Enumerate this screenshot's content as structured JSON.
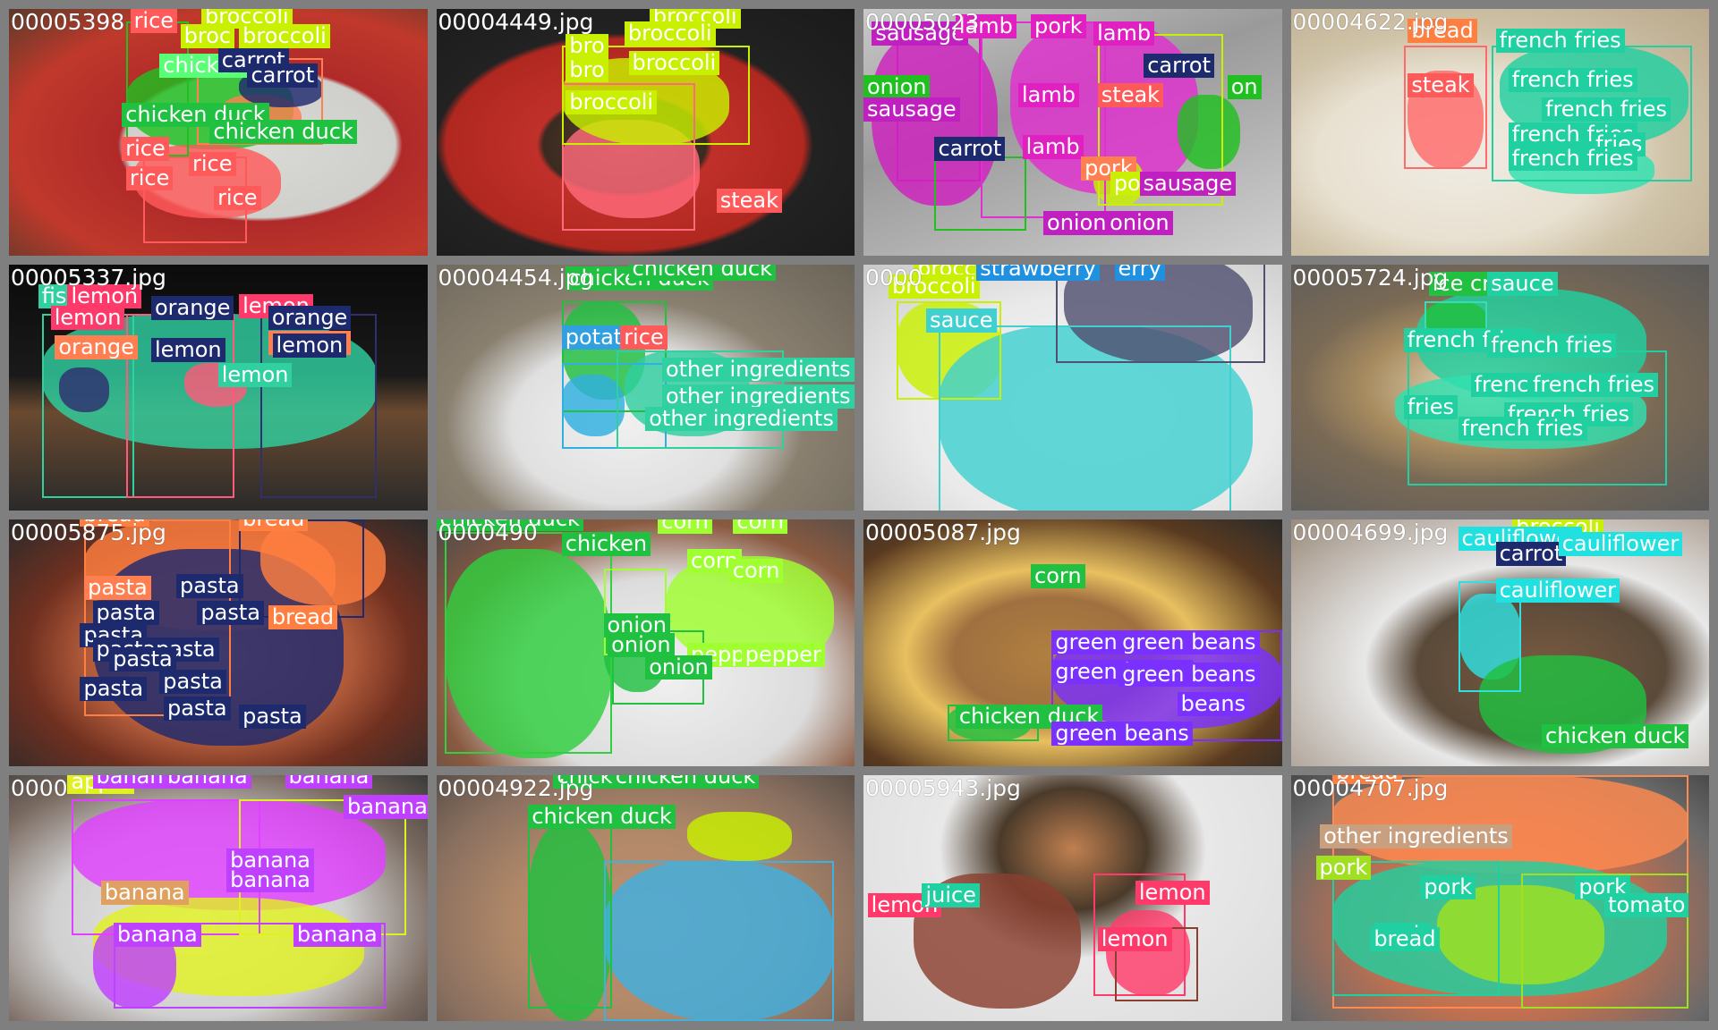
{
  "tiles": [
    {
      "filename": "00005398",
      "bg": "radial-gradient(ellipse at 60% 55%, #d9d9d6 0%, #cfcfcb 38%, #b02a2a 40%, #c0392b 70%, #5a3a2a 100%)",
      "blobs": [
        {
          "color": "#20c020"
        },
        {
          "color": "#ff5a5a"
        },
        {
          "color": "#ff7f50"
        },
        {
          "color": "#1e2a6e"
        }
      ],
      "labels": [
        {
          "text": "rice",
          "color": "#ff5a5a"
        },
        {
          "text": "broccoli",
          "color": "#c8f000"
        },
        {
          "text": "broc",
          "color": "#c8f000"
        },
        {
          "text": "broccoli",
          "color": "#c8f000"
        },
        {
          "text": "chicken",
          "color": "#5aff78"
        },
        {
          "text": "carrot",
          "color": "#1e2a6e"
        },
        {
          "text": "carrot",
          "color": "#1e2a6e"
        },
        {
          "text": "chicken duck",
          "color": "#20c040"
        },
        {
          "text": "chicken duck",
          "color": "#20c040"
        },
        {
          "text": "rice",
          "color": "#ff5a5a"
        },
        {
          "text": "rice",
          "color": "#ff5a5a"
        },
        {
          "text": "rice",
          "color": "#ff5a5a"
        },
        {
          "text": "rice",
          "color": "#ff5a5a"
        }
      ]
    },
    {
      "filename": "00004449.jpg",
      "bg": "radial-gradient(ellipse at 45% 55%, #5a4030 0%, #3a2a20 25%, #c0302a 27%, #b02820 55%, #222 58%, #1a1a1a 100%)",
      "blobs": [
        {
          "color": "#ff6a7a"
        },
        {
          "color": "#c8f000"
        }
      ],
      "labels": [
        {
          "text": "broccoli",
          "color": "#c8f000"
        },
        {
          "text": "bro",
          "color": "#c8f000"
        },
        {
          "text": "broccoli",
          "color": "#c8f000"
        },
        {
          "text": "bro",
          "color": "#c8f000"
        },
        {
          "text": "broccoli",
          "color": "#c8f000"
        },
        {
          "text": "broccoli",
          "color": "#c8f000"
        },
        {
          "text": "steak",
          "color": "#ff5a5a"
        }
      ]
    },
    {
      "filename": "00005023",
      "bg": "linear-gradient(160deg, #c9c9c9 0%, #9a9a9a 40%, #d0d0d0 100%)",
      "blobs": [
        {
          "color": "#d020c0"
        },
        {
          "color": "#e030d0"
        },
        {
          "color": "#20c020"
        },
        {
          "color": "#c8f000"
        }
      ],
      "labels": [
        {
          "text": "sausage",
          "color": "#c020c0"
        },
        {
          "text": "lamb",
          "color": "#e020c0"
        },
        {
          "text": "pork",
          "color": "#e020c0"
        },
        {
          "text": "lamb",
          "color": "#e020c0"
        },
        {
          "text": "onion",
          "color": "#20c020"
        },
        {
          "text": "carrot",
          "color": "#1e2a6e"
        },
        {
          "text": "on",
          "color": "#20c020"
        },
        {
          "text": "sausage",
          "color": "#c020c0"
        },
        {
          "text": "lamb",
          "color": "#e020c0"
        },
        {
          "text": "steak",
          "color": "#ff5a5a"
        },
        {
          "text": "carrot",
          "color": "#1e2a6e"
        },
        {
          "text": "lamb",
          "color": "#e020c0"
        },
        {
          "text": "pork",
          "color": "#ff7f50"
        },
        {
          "text": "pork",
          "color": "#c8f000"
        },
        {
          "text": "sausage",
          "color": "#c020c0"
        },
        {
          "text": "onion",
          "color": "#c020c0"
        },
        {
          "text": "onion",
          "color": "#c020c0"
        }
      ]
    },
    {
      "filename": "00004622.jpg",
      "bg": "radial-gradient(ellipse at 40% 60%, #f0ece4 0%, #e8e0d0 40%, #cfc3a8 60%, #b9a88c 100%)",
      "blobs": [
        {
          "color": "#ff6a6a"
        },
        {
          "color": "#20d0a0"
        },
        {
          "color": "#30e0b0"
        }
      ],
      "labels": [
        {
          "text": "bread",
          "color": "#ff7f40"
        },
        {
          "text": "french fries",
          "color": "#20d0a0"
        },
        {
          "text": "steak",
          "color": "#ff5a5a"
        },
        {
          "text": "french fries",
          "color": "#20d0a0"
        },
        {
          "text": "french fries",
          "color": "#20d0a0"
        },
        {
          "text": "french fries",
          "color": "#20d0a0"
        },
        {
          "text": "fries",
          "color": "#20d0a0"
        },
        {
          "text": "french fries",
          "color": "#20d0a0"
        }
      ]
    },
    {
      "filename": "00005337.jpg",
      "bg": "linear-gradient(180deg, #0b0b0b 0%, #1a1a1a 45%, #6a4a30 60%, #2a2a2a 100%)",
      "blobs": [
        {
          "color": "#30d0a0"
        },
        {
          "color": "#ff5a7a"
        },
        {
          "color": "#303070"
        }
      ],
      "labels": [
        {
          "text": "fish",
          "color": "#30d0a0"
        },
        {
          "text": "lemon",
          "color": "#ff3a6a"
        },
        {
          "text": "lemon",
          "color": "#ff3a6a"
        },
        {
          "text": "orange",
          "color": "#1e2a6e"
        },
        {
          "text": "lemon",
          "color": "#ff3a6a"
        },
        {
          "text": "orange",
          "color": "#ff7f50"
        },
        {
          "text": "lemon",
          "color": "#1e2a6e"
        },
        {
          "text": "orange",
          "color": "#1e2a6e"
        },
        {
          "text": "orange",
          "color": "#ff7f50"
        },
        {
          "text": "lemon",
          "color": "#30d0a0"
        },
        {
          "text": "lemon",
          "color": "#1e2a6e"
        }
      ]
    },
    {
      "filename": "00004454.jpg",
      "bg": "radial-gradient(ellipse at 45% 65%, #f0f0f0 0%, #e0e0e0 35%, #8a8070 55%, #6a6458 100%)",
      "blobs": [
        {
          "color": "#20c040"
        },
        {
          "color": "#30b0e0"
        },
        {
          "color": "#30d0a0"
        }
      ],
      "labels": [
        {
          "text": "chicken duck",
          "color": "#20c040"
        },
        {
          "text": "chicken duck",
          "color": "#20c040"
        },
        {
          "text": "potato",
          "color": "#30a0e0"
        },
        {
          "text": "rice",
          "color": "#ff5a5a"
        },
        {
          "text": "other ingredients",
          "color": "#30d0a0"
        },
        {
          "text": "other ingredients",
          "color": "#30d0a0"
        },
        {
          "text": "other ingredients",
          "color": "#30d0a0"
        }
      ]
    },
    {
      "filename": "0000",
      "bg": "radial-gradient(ellipse at 55% 60%, #f4f4f4 0%, #eaeaea 55%, #c9c9c9 100%)",
      "blobs": [
        {
          "color": "#c8f000"
        },
        {
          "color": "#40d0d0"
        },
        {
          "color": "#505070"
        }
      ],
      "labels": [
        {
          "text": "broccoli",
          "color": "#c8f000"
        },
        {
          "text": "broccoli",
          "color": "#c8f000"
        },
        {
          "text": "strawberry",
          "color": "#2090e0"
        },
        {
          "text": "erry",
          "color": "#2090e0"
        },
        {
          "text": "sauce",
          "color": "#40d0d0"
        }
      ]
    },
    {
      "filename": "00005724.jpg",
      "bg": "radial-gradient(ellipse at 45% 50%, #e8dcc0 0%, #a88c60 35%, #7a6a55 55%, #5a5a5a 100%)",
      "blobs": [
        {
          "color": "#20d0a0"
        },
        {
          "color": "#30e0b0"
        },
        {
          "color": "#20c040"
        }
      ],
      "labels": [
        {
          "text": "ice cream",
          "color": "#20c040"
        },
        {
          "text": "sauce",
          "color": "#20d0a0"
        },
        {
          "text": "french fries",
          "color": "#20d0a0"
        },
        {
          "text": "french fries",
          "color": "#20d0a0"
        },
        {
          "text": "french fries",
          "color": "#20d0a0"
        },
        {
          "text": "french fries",
          "color": "#20d0a0"
        },
        {
          "text": "fries",
          "color": "#20d0a0"
        },
        {
          "text": "french fries",
          "color": "#20d0a0"
        },
        {
          "text": "french fries",
          "color": "#20d0a0"
        }
      ]
    },
    {
      "filename": "00005875.jpg",
      "bg": "radial-gradient(ellipse at 50% 55%, #d08060 0%, #b05a3a 45%, #703020 65%, #2a2a2a 100%)",
      "blobs": [
        {
          "color": "#ff7f40"
        },
        {
          "color": "#1e2a6e"
        },
        {
          "color": "#ff7f40"
        }
      ],
      "labels": [
        {
          "text": "bread",
          "color": "#ff7f40"
        },
        {
          "text": "bread",
          "color": "#ff7f40"
        },
        {
          "text": "pasta",
          "color": "#ff7f50"
        },
        {
          "text": "pasta",
          "color": "#1e2a6e"
        },
        {
          "text": "pasta",
          "color": "#1e2a6e"
        },
        {
          "text": "pasta",
          "color": "#1e2a6e"
        },
        {
          "text": "pasta",
          "color": "#1e2a6e"
        },
        {
          "text": "bread",
          "color": "#ff7f40"
        },
        {
          "text": "pastapasta",
          "color": "#1e2a6e"
        },
        {
          "text": "pasta",
          "color": "#1e2a6e"
        },
        {
          "text": "pasta",
          "color": "#1e2a6e"
        },
        {
          "text": "pasta",
          "color": "#1e2a6e"
        },
        {
          "text": "pasta",
          "color": "#1e2a6e"
        },
        {
          "text": "pasta",
          "color": "#1e2a6e"
        }
      ]
    },
    {
      "filename": "0000490",
      "bg": "radial-gradient(ellipse at 55% 65%, #f0f0f0 0%, #dcdcdc 45%, #8a5a40 70%, #4a4a4a 100%)",
      "blobs": [
        {
          "color": "#30d040"
        },
        {
          "color": "#a0ff30"
        },
        {
          "color": "#20c040"
        }
      ],
      "labels": [
        {
          "text": "chicken duck",
          "color": "#20c040"
        },
        {
          "text": "chicken",
          "color": "#20c040"
        },
        {
          "text": "corn",
          "color": "#a0ff30"
        },
        {
          "text": "corn",
          "color": "#a0ff30"
        },
        {
          "text": "corn",
          "color": "#a0ff30"
        },
        {
          "text": "corn",
          "color": "#a0ff30"
        },
        {
          "text": "onion",
          "color": "#20c040"
        },
        {
          "text": "pepper",
          "color": "#a0ff30"
        },
        {
          "text": "onion",
          "color": "#20c040"
        },
        {
          "text": "onion",
          "color": "#20c040"
        },
        {
          "text": "pepper",
          "color": "#a0ff30"
        }
      ]
    },
    {
      "filename": "00005087.jpg",
      "bg": "radial-gradient(ellipse at 45% 55%, #b08040 0%, #a07040 30%, #e8c060 45%, #5a3a20 75%, #2a2a2a 100%)",
      "blobs": [
        {
          "color": "#7a30ff"
        },
        {
          "color": "#20c040"
        }
      ],
      "labels": [
        {
          "text": "corn",
          "color": "#20c040"
        },
        {
          "text": "green beans",
          "color": "#7a30ff"
        },
        {
          "text": "green beans",
          "color": "#7a30ff"
        },
        {
          "text": "green beans",
          "color": "#7a30ff"
        },
        {
          "text": "green beans",
          "color": "#7a30ff"
        },
        {
          "text": "beans",
          "color": "#7a30ff"
        },
        {
          "text": "chicken duck",
          "color": "#20c040"
        },
        {
          "text": "green beans",
          "color": "#7a30ff"
        }
      ]
    },
    {
      "filename": "00004699.jpg",
      "bg": "radial-gradient(ellipse at 60% 60%, #7a5a40 0%, #5a4a3a 35%, #e8e8e8 50%, #9a8a7a 100%)",
      "blobs": [
        {
          "color": "#30e0e0"
        },
        {
          "color": "#20c040"
        }
      ],
      "labels": [
        {
          "text": "broccoli",
          "color": "#c8f000"
        },
        {
          "text": "cauliflower",
          "color": "#20e0e0"
        },
        {
          "text": "carrot",
          "color": "#1e2a6e"
        },
        {
          "text": "cauliflower",
          "color": "#20e0e0"
        },
        {
          "text": "cauliflower",
          "color": "#20e0e0"
        },
        {
          "text": "chicken duck",
          "color": "#20c040"
        }
      ]
    },
    {
      "filename": "0000",
      "bg": "radial-gradient(ellipse at 45% 60%, #e8e8e8 0%, #d0d0d0 45%, #7a6a60 75%, #3a3a3a 100%)",
      "blobs": [
        {
          "color": "#e040ff"
        },
        {
          "color": "#e0f020"
        },
        {
          "color": "#c040ff"
        }
      ],
      "labels": [
        {
          "text": "apple",
          "color": "#e0f020"
        },
        {
          "text": "banana",
          "color": "#c040ff"
        },
        {
          "text": "banana",
          "color": "#c040ff"
        },
        {
          "text": "banana",
          "color": "#c040ff"
        },
        {
          "text": "banana",
          "color": "#c040ff"
        },
        {
          "text": "banana",
          "color": "#c040ff"
        },
        {
          "text": "banana",
          "color": "#e0a060"
        },
        {
          "text": "banana",
          "color": "#c040ff"
        },
        {
          "text": "banana",
          "color": "#c040ff"
        },
        {
          "text": "banana",
          "color": "#c040ff"
        }
      ]
    },
    {
      "filename": "00004922.jpg",
      "bg": "radial-gradient(ellipse at 50% 60%, #c09070 0%, #b08868 45%, #8a7060 75%, #5a5048 100%)",
      "blobs": [
        {
          "color": "#20c040"
        },
        {
          "color": "#40b0e0"
        },
        {
          "color": "#c8f000"
        }
      ],
      "labels": [
        {
          "text": "chicken duck",
          "color": "#20c040"
        },
        {
          "text": "chicken duck",
          "color": "#20c040"
        },
        {
          "text": "chicken duck",
          "color": "#20c040"
        }
      ]
    },
    {
      "filename": "00005943.jpg",
      "bg": "radial-gradient(ellipse at 50% 30%, #c08050 0%, #4a3a2a 25%, #e8e8e8 45%, #dcdcdc 100%)",
      "blobs": [
        {
          "color": "#ff3a6a"
        },
        {
          "color": "#8a4030"
        }
      ],
      "labels": [
        {
          "text": "lemon",
          "color": "#ff3a6a"
        },
        {
          "text": "juice",
          "color": "#20d0a0"
        },
        {
          "text": "lemon",
          "color": "#ff3a6a"
        },
        {
          "text": "lemon",
          "color": "#ff3a6a"
        }
      ]
    },
    {
      "filename": "00004707.jpg",
      "bg": "radial-gradient(ellipse at 50% 60%, #e08060 0%, #c07050 45%, #6a6a6a 80%, #4a4a4a 100%)",
      "blobs": [
        {
          "color": "#ff8a50"
        },
        {
          "color": "#20d0a0"
        },
        {
          "color": "#a0e020"
        }
      ],
      "labels": [
        {
          "text": "bread",
          "color": "#ff7f40"
        },
        {
          "text": "other ingredients",
          "color": "#c8a080"
        },
        {
          "text": "pork",
          "color": "#a0e020"
        },
        {
          "text": "pork",
          "color": "#20d0a0"
        },
        {
          "text": "pork",
          "color": "#20d0a0"
        },
        {
          "text": "pork",
          "color": "#20d0a0"
        },
        {
          "text": "bread",
          "color": "#20d0a0"
        },
        {
          "text": "tomato",
          "color": "#20d0a0"
        }
      ]
    }
  ]
}
